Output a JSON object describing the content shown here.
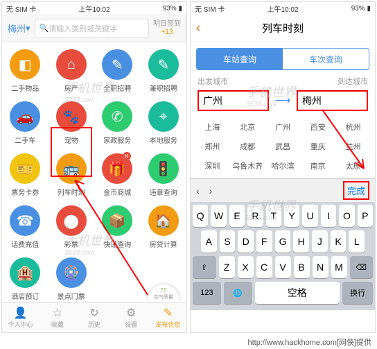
{
  "status": {
    "carrier": "无 SIM 卡",
    "wifi": "ᯤ",
    "time": "上午10:02",
    "battery_pct": "93%",
    "battery_icon": "▮"
  },
  "left": {
    "location": "梅州",
    "search_placeholder": "请输入类别或关键字",
    "signin_l1": "明日签到",
    "signin_l2": "+13",
    "items": [
      {
        "label": "二手物品",
        "color": "#f39c12",
        "glyph": "◧"
      },
      {
        "label": "房产",
        "color": "#e74c3c",
        "glyph": "⌂"
      },
      {
        "label": "全职招聘",
        "color": "#4a90e2",
        "glyph": "✎"
      },
      {
        "label": "兼职招聘",
        "color": "#1abc9c",
        "glyph": "✎"
      },
      {
        "label": "二手车",
        "color": "#4a90e2",
        "glyph": "🚗"
      },
      {
        "label": "宠物",
        "color": "#e74c3c",
        "glyph": "🐾"
      },
      {
        "label": "家政服务",
        "color": "#2ecc71",
        "glyph": "✆"
      },
      {
        "label": "本地服务",
        "color": "#1abc9c",
        "glyph": "⌖"
      },
      {
        "label": "票务卡券",
        "color": "#f1c40f",
        "glyph": "🎫"
      },
      {
        "label": "列车时刻",
        "color": "#f39c12",
        "glyph": "🚌"
      },
      {
        "label": "金币商城",
        "color": "#e74c3c",
        "glyph": "🎁",
        "badge": "H"
      },
      {
        "label": "违章查询",
        "color": "#2ecc71",
        "glyph": "🚦"
      },
      {
        "label": "话费充值",
        "color": "#4a90e2",
        "glyph": "☎"
      },
      {
        "label": "彩票",
        "color": "#e74c3c",
        "glyph": "⬤"
      },
      {
        "label": "快递查询",
        "color": "#2ecc71",
        "glyph": "📦"
      },
      {
        "label": "房贷计算",
        "color": "#f39c12",
        "glyph": "🏠"
      },
      {
        "label": "酒店预订",
        "color": "#1abc9c",
        "glyph": "🏨"
      },
      {
        "label": "景点门票",
        "color": "#4a90e2",
        "glyph": "🎡"
      }
    ],
    "gauge": {
      "value": "77",
      "label": "空气质量"
    },
    "tabs": [
      {
        "label": "个人中心",
        "glyph": "👤"
      },
      {
        "label": "收藏",
        "glyph": "☆"
      },
      {
        "label": "历史",
        "glyph": "↻"
      },
      {
        "label": "设置",
        "glyph": "⚙"
      },
      {
        "label": "发布信息",
        "glyph": "✎",
        "active": true
      }
    ]
  },
  "right": {
    "title": "列车时刻",
    "seg": {
      "a": "车站查询",
      "b": "车次查询"
    },
    "from_label": "出发城市",
    "to_label": "到达城市",
    "from_value": "广州",
    "to_value": "梅州",
    "cities": [
      "上海",
      "北京",
      "广州",
      "西安",
      "杭州",
      "郑州",
      "成都",
      "武昌",
      "重庆",
      "兰州",
      "深圳",
      "乌鲁木齐",
      "哈尔滨",
      "南京",
      "太原"
    ],
    "done": "完成",
    "kb": {
      "r1": [
        "Q",
        "W",
        "E",
        "R",
        "T",
        "Y",
        "U",
        "I",
        "O",
        "P"
      ],
      "r2": [
        "A",
        "S",
        "D",
        "F",
        "G",
        "H",
        "J",
        "K",
        "L"
      ],
      "r3": [
        "Z",
        "X",
        "C",
        "V",
        "B",
        "N",
        "M"
      ],
      "shift": "⇧",
      "del": "⌫",
      "num": "123",
      "globe": "🌐",
      "space": "空格",
      "ret": "换行"
    }
  },
  "watermark": {
    "text": "手机世界",
    "domain": "3533.com"
  },
  "footer": "http://www.hackhome.com[网侠]提供"
}
